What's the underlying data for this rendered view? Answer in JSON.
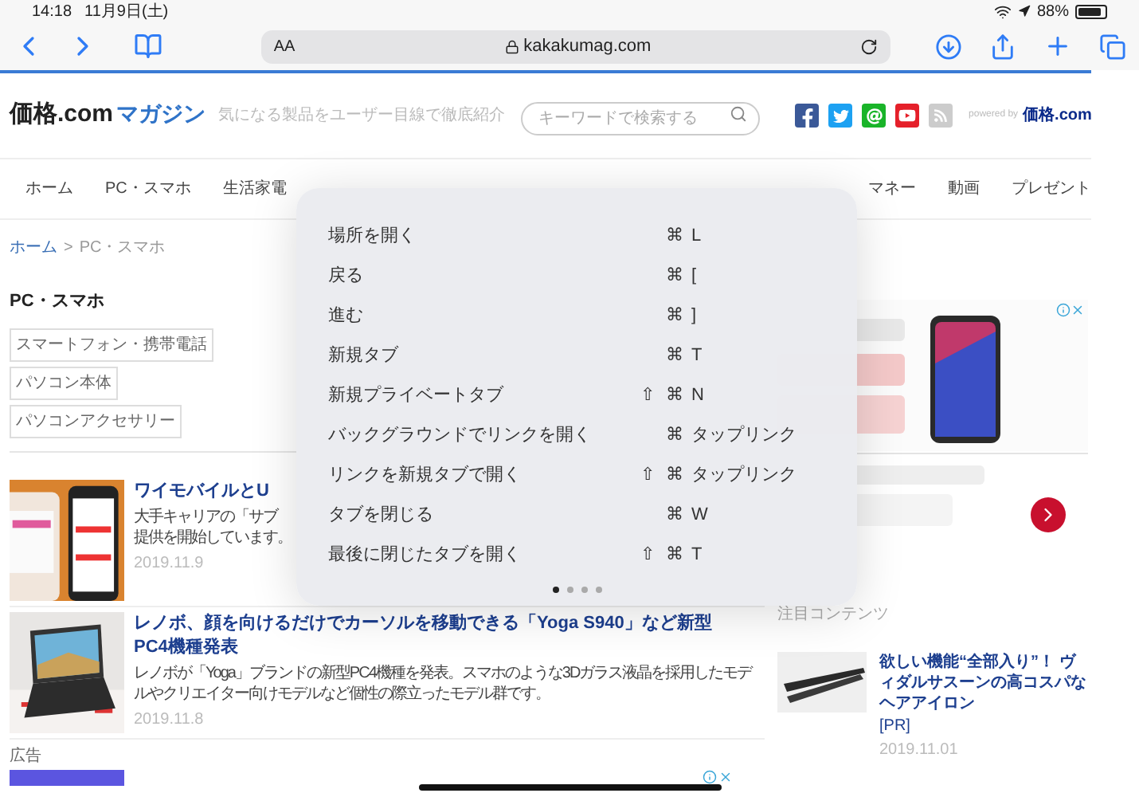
{
  "status_bar": {
    "time": "14:18",
    "date": "11月9日(土)",
    "battery": "88%"
  },
  "toolbar": {
    "text_size": "AA",
    "url": "kakakumag.com"
  },
  "site": {
    "logo": "価格.com",
    "logo_suffix": "マガジン",
    "tagline": "気になる製品をユーザー目線で徹底紹介",
    "search_placeholder": "キーワードで検索する",
    "powered_by": "powered by",
    "powered_logo": "価格.com"
  },
  "nav_left": [
    "ホーム",
    "PC・スマホ",
    "生活家電"
  ],
  "nav_right": [
    "マネー",
    "動画",
    "プレゼント"
  ],
  "breadcrumb": {
    "items": [
      "ホーム",
      "PC・スマホ"
    ],
    "separator": ">"
  },
  "category": {
    "title": "PC・スマホ",
    "tags": [
      "スマートフォン・携帯電話",
      "パソコン本体",
      "パソコンアクセサリー"
    ]
  },
  "articles": [
    {
      "title": [
        "ワイモバイルとU"
      ],
      "description": [
        "大手キャリアの「サブ",
        "提供を開始しています。"
      ],
      "date": "2019.11.9"
    },
    {
      "title": [
        "レノボ、顔を向けるだけでカーソルを移動できる「Yoga S940」など新型",
        "PC4機種発表"
      ],
      "description": [
        "レノボが「Yoga」ブランドの新型PC4機種を発表。スマホのような3Dガラス液晶を採用したモデルやクリエイター向けモデルなど個性の際立ったモデル群です。"
      ],
      "date": "2019.11.8"
    }
  ],
  "ad_label": "広告",
  "sidebar": {
    "featured_heading": "注目コンテンツ",
    "featured": {
      "title": "欲しい機能“全部入り”！ ヴィダルサスーンの高コスパなヘアアイロン",
      "tag": "[PR]",
      "date": "2019.11.01"
    }
  },
  "shortcuts": [
    {
      "label": "場所を開く",
      "cmd": "⌘",
      "key": "L"
    },
    {
      "label": "戻る",
      "cmd": "⌘",
      "key": "["
    },
    {
      "label": "進む",
      "cmd": "⌘",
      "key": "]"
    },
    {
      "label": "新規タブ",
      "cmd": "⌘",
      "key": "T"
    },
    {
      "label": "新規プライベートタブ",
      "shift": "⇧",
      "cmd": "⌘",
      "key": "N"
    },
    {
      "label": "バックグラウンドでリンクを開く",
      "cmd": "⌘",
      "key": "タップリンク"
    },
    {
      "label": "リンクを新規タブで開く",
      "shift": "⇧",
      "cmd": "⌘",
      "key": "タップリンク"
    },
    {
      "label": "タブを閉じる",
      "cmd": "⌘",
      "key": "W"
    },
    {
      "label": "最後に閉じたタブを開く",
      "shift": "⇧",
      "cmd": "⌘",
      "key": "T"
    }
  ],
  "pages": [
    {
      "selected": true
    },
    {
      "selected": false
    },
    {
      "selected": false
    },
    {
      "selected": false
    }
  ]
}
